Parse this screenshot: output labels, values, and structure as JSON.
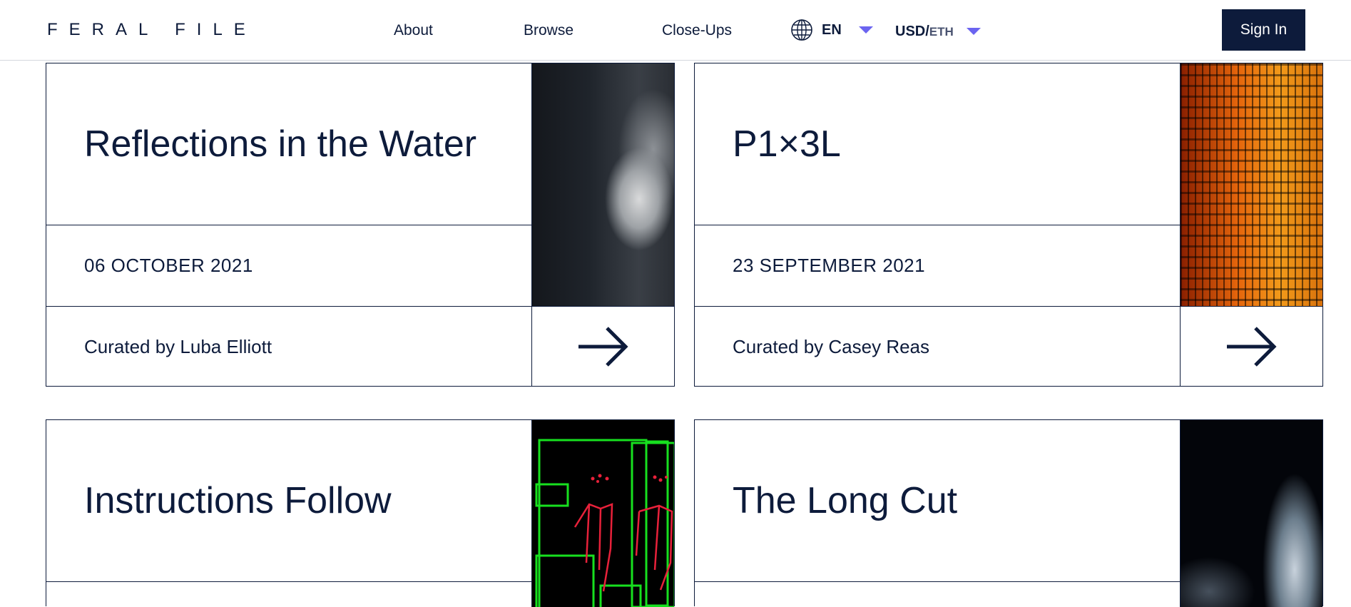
{
  "header": {
    "logo": "FERAL FILE",
    "nav": [
      "About",
      "Browse",
      "Close-Ups"
    ],
    "language": "EN",
    "currency_main": "USD/",
    "currency_sub": "ETH",
    "sign_in": "Sign In"
  },
  "exhibitions": [
    {
      "title": "Reflections in the Water",
      "date": "06 OCTOBER 2021",
      "curator": "Curated by Luba Elliott",
      "thumbnail": "portrait-of-woman"
    },
    {
      "title": "P1×3L",
      "date": "23 SEPTEMBER 2021",
      "curator": "Curated by Casey Reas",
      "thumbnail": "orange-pixel-grid"
    },
    {
      "title": "Instructions Follow",
      "date": "",
      "curator": "",
      "thumbnail": "green-wireframe"
    },
    {
      "title": "The Long Cut",
      "date": "",
      "curator": "",
      "thumbnail": "glass-in-dark"
    }
  ],
  "colors": {
    "navy": "#0d1b3b",
    "accent": "#6b64f0",
    "border": "#d4d7de"
  }
}
